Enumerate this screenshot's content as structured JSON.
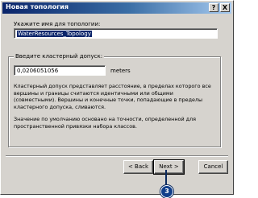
{
  "window": {
    "title": "Новая топология",
    "help_label": "?",
    "close_label": "X"
  },
  "name_section": {
    "label": "Укажите имя для топологии:",
    "value": "WaterResources_Topology"
  },
  "tolerance_section": {
    "label": "Введите кластерный допуск:",
    "value": "0,0206051056",
    "units": "meters",
    "description": "Кластерный допуск представляет расстояние, в пределах которого все вершины и границы считаются идентичными или общими (совместными). Вершины и конечные точки, попадающие в пределы кластерного допуска, сливаются.",
    "default_note": "Значение по умолчанию основано на точности, определенной для пространственной привязки набора классов."
  },
  "buttons": {
    "back": "< Back",
    "next": "Next >",
    "cancel": "Cancel"
  },
  "callout": {
    "number": "3",
    "color": "#123f8a"
  }
}
